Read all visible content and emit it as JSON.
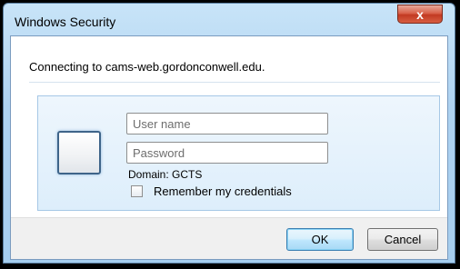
{
  "window": {
    "title": "Windows Security",
    "close_symbol": "x"
  },
  "dialog": {
    "message": "Connecting to cams-web.gordonconwell.edu."
  },
  "credentials": {
    "username_placeholder": "User name",
    "password_placeholder": "Password",
    "domain_text": "Domain: GCTS",
    "remember_label": "Remember my credentials",
    "remember_checked": false
  },
  "buttons": {
    "ok_label": "OK",
    "cancel_label": "Cancel"
  },
  "colors": {
    "accent": "#3c7fb1",
    "close_button": "#c23a22",
    "panel_background": "#ddeefb"
  },
  "icons": {
    "close": "close-icon",
    "user_tile": "user-tile-icon"
  }
}
